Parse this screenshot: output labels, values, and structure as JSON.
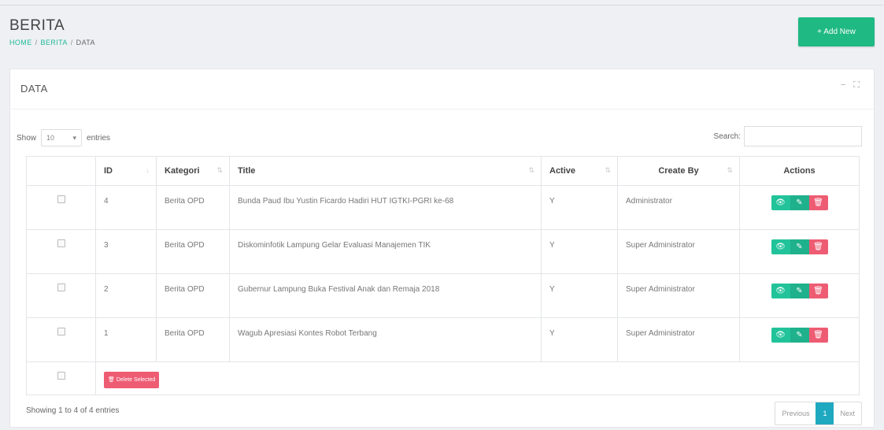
{
  "header": {
    "title": "BERITA",
    "breadcrumb": [
      "HOME",
      "BERITA",
      "DATA"
    ],
    "breadcrumb_sep": "/",
    "add_button": "+ Add New"
  },
  "card": {
    "title": "DATA",
    "minimize_icon": "−",
    "fullscreen_icon": "⛶"
  },
  "controls": {
    "show_label": "Show",
    "length_value": "10",
    "entries_label": "entries",
    "search_label": "Search:",
    "search_value": ""
  },
  "table": {
    "columns": [
      "",
      "ID",
      "Kategori",
      "Title",
      "Active",
      "Create By",
      "Actions"
    ],
    "rows": [
      {
        "id": "4",
        "kategori": "Berita OPD",
        "title": "Bunda Paud Ibu Yustin Ficardo Hadiri HUT IGTKI-PGRI ke-68",
        "active": "Y",
        "create_by": "Administrator"
      },
      {
        "id": "3",
        "kategori": "Berita OPD",
        "title": "Diskominfotik Lampung Gelar Evaluasi Manajemen TIK",
        "active": "Y",
        "create_by": "Super Administrator"
      },
      {
        "id": "2",
        "kategori": "Berita OPD",
        "title": "Gubernur Lampung Buka Festival Anak dan Remaja 2018",
        "active": "Y",
        "create_by": "Super Administrator"
      },
      {
        "id": "1",
        "kategori": "Berita OPD",
        "title": "Wagub Apresiasi Kontes Robot Terbang",
        "active": "Y",
        "create_by": "Super Administrator"
      }
    ],
    "delete_selected": "Delete Selected"
  },
  "footer": {
    "info": "Showing 1 to 4 of 4 entries",
    "previous": "Previous",
    "page": "1",
    "next": "Next"
  },
  "colors": {
    "accent": "#1fb983",
    "danger": "#ee5c73",
    "pager_active": "#1fa9c0"
  }
}
